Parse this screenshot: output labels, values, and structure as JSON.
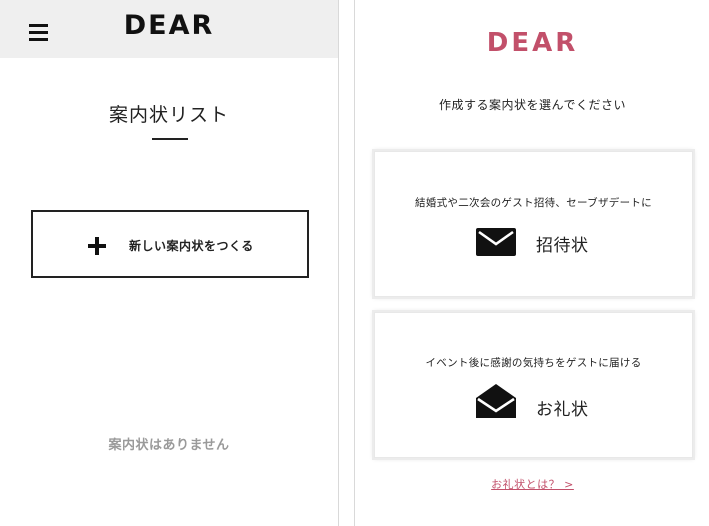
{
  "left": {
    "header": {
      "brand": "DEAR",
      "menu_icon": "hamburger-menu-icon"
    },
    "page_title": "案内状リスト",
    "new_button": {
      "icon": "plus-icon",
      "label": "新しい案内状をつくる"
    },
    "empty_message": "案内状はありません"
  },
  "right": {
    "brand": "DEAR",
    "prompt": "作成する案内状を選んでください",
    "options": [
      {
        "description": "結婚式や二次会のゲスト招待、セーブザデートに",
        "icon": "envelope-closed-icon",
        "label": "招待状"
      },
      {
        "description": "イベント後に感謝の気持ちをゲストに届ける",
        "icon": "envelope-open-icon",
        "label": "お礼状"
      }
    ],
    "link_text": "お礼状とは？ >"
  },
  "colors": {
    "brand_pink": "#c2506a",
    "header_bg": "#efefef",
    "empty_text": "#9a9a9a"
  }
}
